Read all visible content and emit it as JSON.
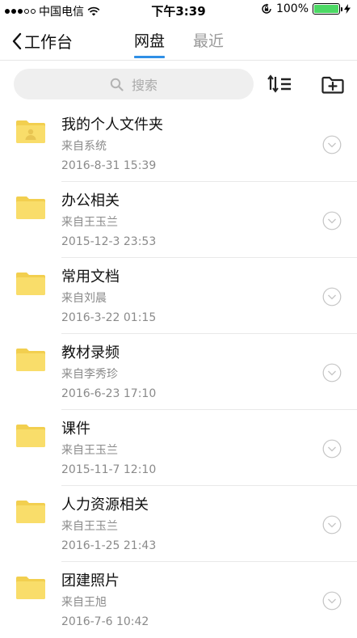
{
  "status_bar": {
    "carrier": "中国电信",
    "time": "下午3:39",
    "battery": "100%",
    "battery_color": "#4cd964"
  },
  "nav": {
    "back_label": "工作台",
    "tabs": [
      {
        "label": "网盘",
        "active": true
      },
      {
        "label": "最近",
        "active": false
      }
    ],
    "accent": "#2f8fe6"
  },
  "search": {
    "placeholder": "搜索",
    "icon": "search-icon"
  },
  "toolbar": {
    "sort_icon": "sort-icon",
    "new_folder_icon": "new-folder-icon"
  },
  "files": [
    {
      "name": "我的个人文件夹",
      "from": "来自系统",
      "time": "2016-8-31  15:39",
      "icon": "personal-folder-icon"
    },
    {
      "name": "办公相关",
      "from": "来自王玉兰",
      "time": "2015-12-3  23:53",
      "icon": "folder-icon"
    },
    {
      "name": "常用文档",
      "from": "来自刘晨",
      "time": "2016-3-22  01:15",
      "icon": "folder-icon"
    },
    {
      "name": "教材录频",
      "from": "来自李秀珍",
      "time": "2016-6-23  17:10",
      "icon": "folder-icon"
    },
    {
      "name": "课件",
      "from": "来自王玉兰",
      "time": "2015-11-7  12:10",
      "icon": "folder-icon"
    },
    {
      "name": "人力资源相关",
      "from": "来自王玉兰",
      "time": "2016-1-25  21:43",
      "icon": "folder-icon"
    },
    {
      "name": "团建照片",
      "from": "来自王旭",
      "time": "2016-7-6  10:42",
      "icon": "folder-icon"
    }
  ],
  "colors": {
    "folder": "#f9dd6a",
    "folder_dark": "#f2cf4f"
  }
}
